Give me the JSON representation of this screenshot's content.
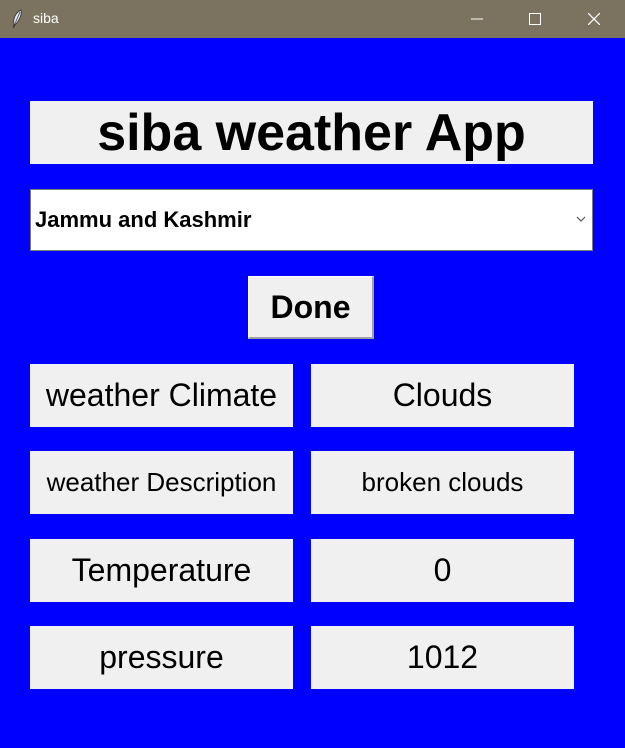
{
  "window": {
    "title": "siba"
  },
  "app": {
    "title": "siba weather App",
    "state_select": {
      "value": "Jammu and Kashmir"
    },
    "done_label": "Done"
  },
  "results": {
    "climate": {
      "label": "weather Climate",
      "value": "Clouds"
    },
    "description": {
      "label": "weather Description",
      "value": "broken clouds"
    },
    "temperature": {
      "label": "Temperature",
      "value": "0"
    },
    "pressure": {
      "label": "pressure",
      "value": "1012"
    }
  },
  "colors": {
    "background": "#0000ff",
    "panel": "#f0f0f0",
    "titlebar": "#7b735f"
  }
}
